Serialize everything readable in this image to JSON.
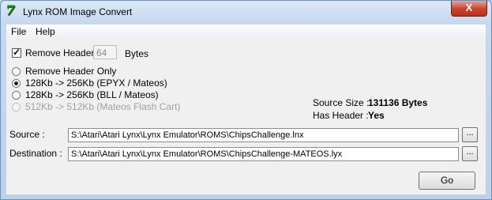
{
  "window": {
    "title": "Lynx ROM Image Convert",
    "close_glyph": "X",
    "app_icon": "7"
  },
  "menu": {
    "file": "File",
    "help": "Help"
  },
  "header": {
    "remove_header_label": "Remove Header",
    "remove_header_checked": true,
    "header_size_value": "64",
    "bytes_label": "Bytes"
  },
  "options": [
    {
      "label": "Remove Header Only",
      "selected": false,
      "enabled": true
    },
    {
      "label": "128Kb -> 256Kb (EPYX / Mateos)",
      "selected": true,
      "enabled": true
    },
    {
      "label": "128Kb -> 256Kb (BLL / Mateos)",
      "selected": false,
      "enabled": true
    },
    {
      "label": "512Kb -> 512Kb (Mateos Flash Cart)",
      "selected": false,
      "enabled": false
    }
  ],
  "info": {
    "source_size_label": "Source Size :",
    "source_size_value": "131136 Bytes",
    "has_header_label": "Has Header :",
    "has_header_value": "Yes"
  },
  "source": {
    "label": "Source :",
    "value": "S:\\Atari\\Atari Lynx\\Lynx Emulator\\ROMS\\ChipsChallenge.lnx",
    "browse_label": "..."
  },
  "destination": {
    "label": "Destination :",
    "value": "S:\\Atari\\Atari Lynx\\Lynx Emulator\\ROMS\\ChipsChallenge-MATEOS.lyx",
    "browse_label": "..."
  },
  "actions": {
    "go_label": "Go"
  }
}
